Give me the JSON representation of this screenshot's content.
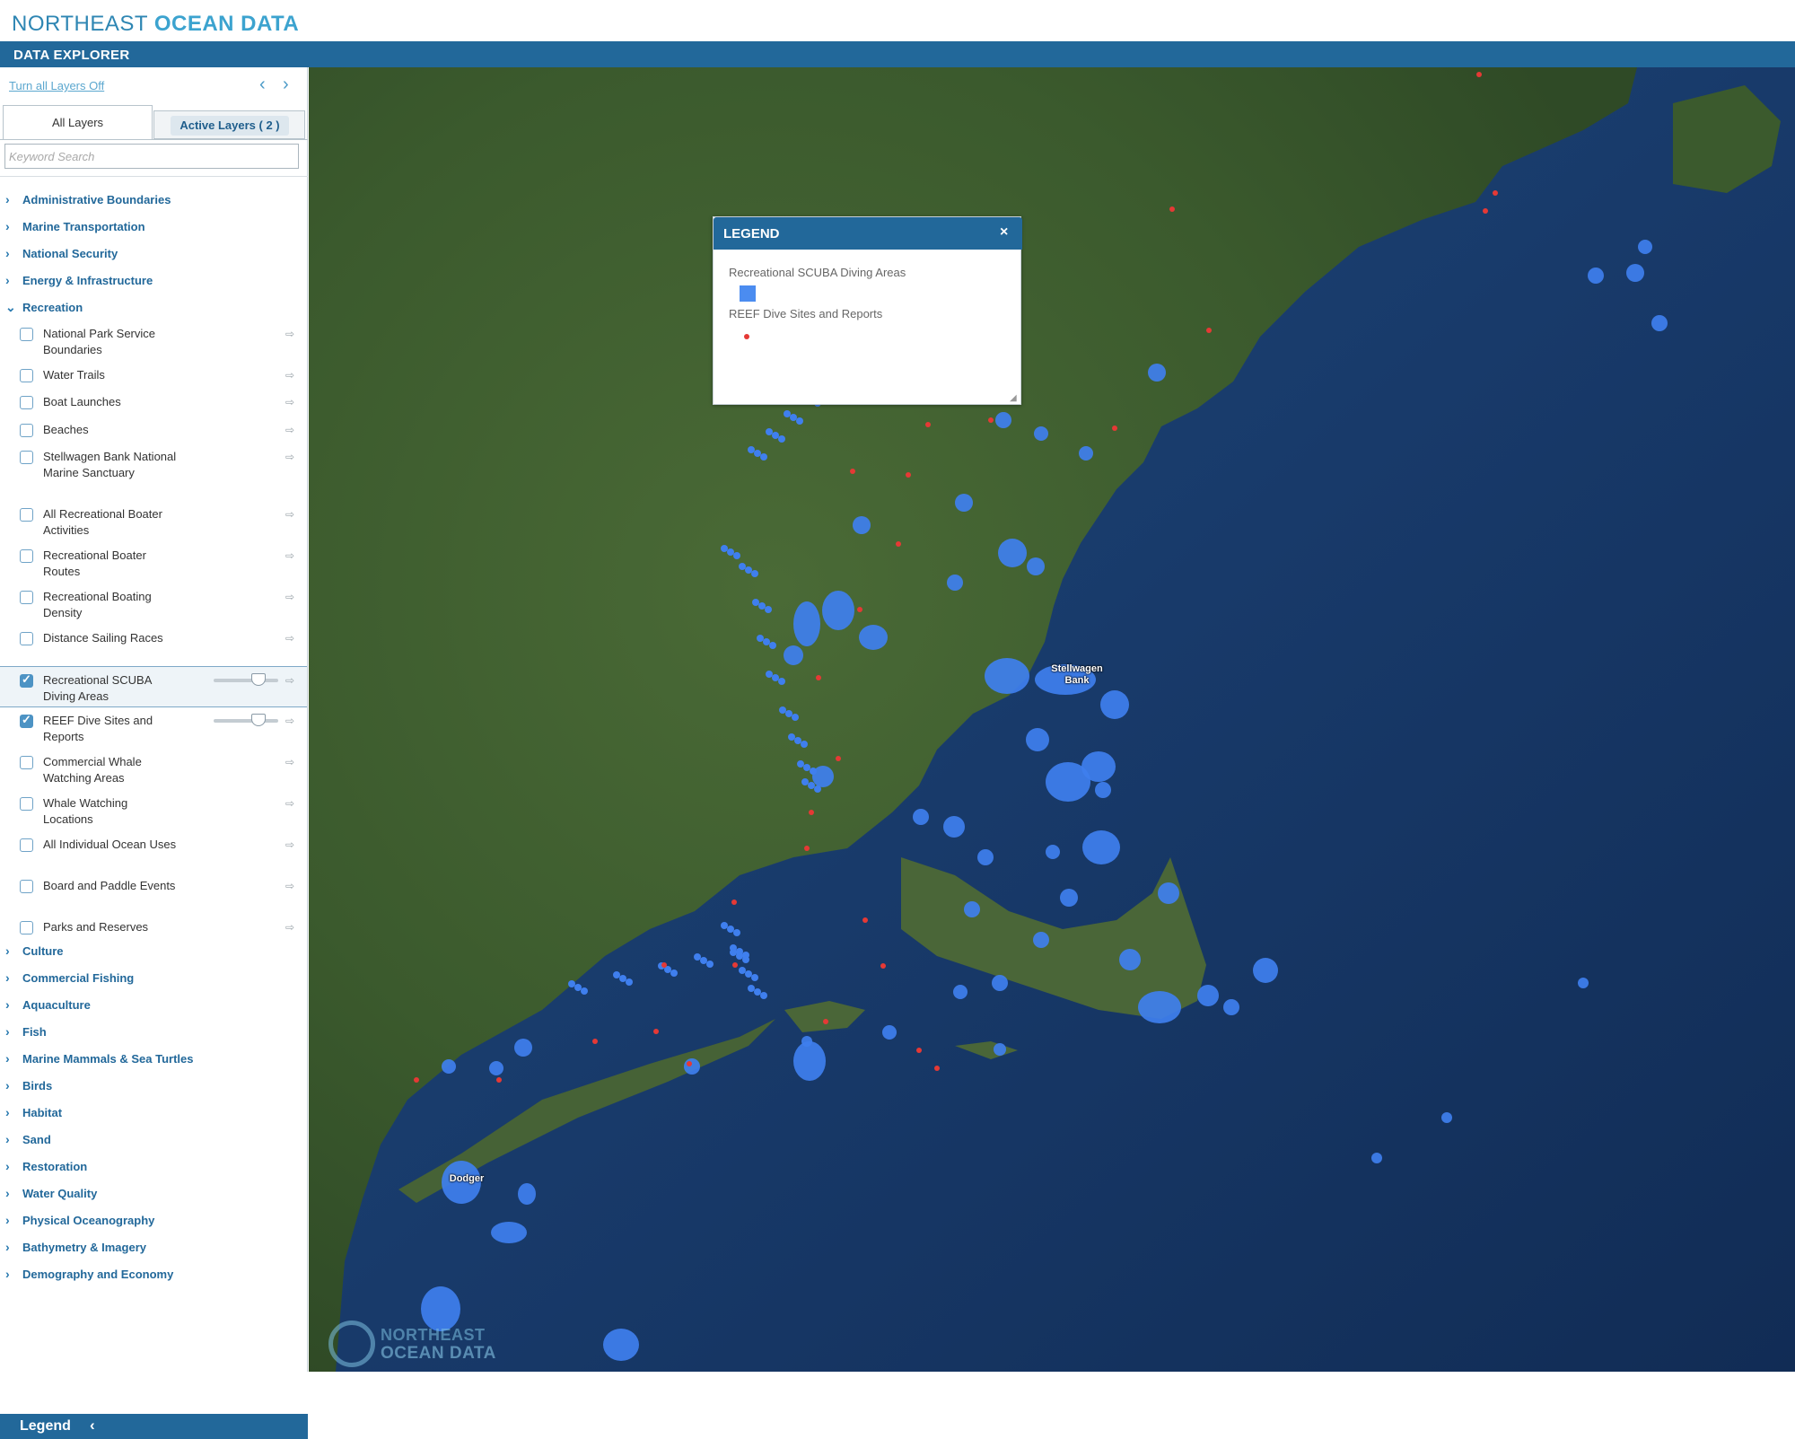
{
  "brand": {
    "part1": "NORTHEAST ",
    "part2": "OCEAN DATA"
  },
  "explorer_title": "DATA EXPLORER",
  "sidebar": {
    "turn_off_label": "Turn all Layers Off",
    "prev_icon": "chevron-left-icon",
    "next_icon": "chevron-right-icon",
    "tabs": {
      "all": "All Layers",
      "active": "Active Layers ( 2 )"
    },
    "search_placeholder": "Keyword Search",
    "categories_top": [
      "Administrative Boundaries",
      "Marine Transportation",
      "National Security",
      "Energy & Infrastructure",
      "Recreation"
    ],
    "recreation_layers": [
      {
        "label": "National Park Service Boundaries",
        "checked": false
      },
      {
        "label": "Water Trails",
        "checked": false
      },
      {
        "label": "Boat Launches",
        "checked": false
      },
      {
        "label": "Beaches",
        "checked": false
      },
      {
        "label": "Stellwagen Bank National Marine Sanctuary",
        "checked": false
      },
      {
        "label": "All Recreational Boater Activities",
        "checked": false
      },
      {
        "label": "Recreational Boater Routes",
        "checked": false
      },
      {
        "label": "Recreational Boating Density",
        "checked": false
      },
      {
        "label": "Distance Sailing Races",
        "checked": false
      },
      {
        "label": "Recreational SCUBA Diving Areas",
        "checked": true
      },
      {
        "label": "REEF Dive Sites and Reports",
        "checked": true
      },
      {
        "label": "Commercial Whale Watching Areas",
        "checked": false
      },
      {
        "label": "Whale Watching Locations",
        "checked": false
      },
      {
        "label": "All Individual Ocean Uses",
        "checked": false
      },
      {
        "label": "Board and Paddle Events",
        "checked": false
      },
      {
        "label": "Parks and Reserves",
        "checked": false
      }
    ],
    "categories_bottom": [
      "Culture",
      "Commercial Fishing",
      "Aquaculture",
      "Fish",
      "Marine Mammals & Sea Turtles",
      "Birds",
      "Habitat",
      "Sand",
      "Restoration",
      "Water Quality",
      "Physical Oceanography",
      "Bathymetry & Imagery",
      "Demography and Economy"
    ],
    "legend_footer": "Legend"
  },
  "legend_panel": {
    "title": "LEGEND",
    "close_icon": "close-icon",
    "items": [
      {
        "label": "Recreational SCUBA Diving Areas",
        "color": "#4b8cf0"
      },
      {
        "label": "REEF Dive Sites and Reports",
        "color": "#e53935"
      }
    ]
  },
  "map": {
    "labels": {
      "stellwagen": "Stellwagen Bank",
      "dodger": "Dodger"
    },
    "watermark": {
      "line1": "NORTHEAST",
      "line2": "OCEAN DATA"
    },
    "colors": {
      "land": "#3c5a2e",
      "ocean": "#19386a",
      "scuba": "#3f7fee",
      "reef": "#e53935"
    }
  },
  "colors": {
    "header_bar": "#22689a",
    "brand": "#2e86b3",
    "link": "#22689a"
  }
}
